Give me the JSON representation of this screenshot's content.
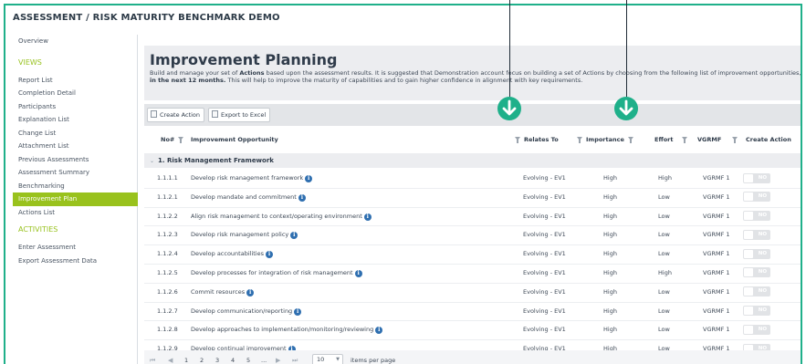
{
  "app": {
    "title": "ASSESSMENT / RISK MATURITY BENCHMARK DEMO"
  },
  "sidebar": {
    "top_items": [
      "Overview"
    ],
    "views_header": "VIEWS",
    "views_items": [
      {
        "label": "Report List"
      },
      {
        "label": "Completion Detail"
      },
      {
        "label": "Participants"
      },
      {
        "label": "Explanation List"
      },
      {
        "label": "Change List"
      },
      {
        "label": "Attachment List"
      },
      {
        "label": "Previous Assessments"
      },
      {
        "label": "Assessment Summary"
      },
      {
        "label": "Benchmarking"
      },
      {
        "label": "Improvement Plan",
        "active": true
      },
      {
        "label": "Actions List"
      }
    ],
    "activities_header": "ACTIVITIES",
    "activities_items": [
      {
        "label": "Enter Assessment"
      },
      {
        "label": "Export Assessment Data"
      }
    ]
  },
  "page": {
    "title": "Improvement Planning",
    "intro_line1_a": "Build and manage your set of ",
    "intro_line1_b": "Actions",
    "intro_line1_c": " based upon the assessment results. It is suggested that Demonstration account focus on building a set of Actions by choosing from the following list of improvement opportunities, a",
    "intro_line2_a": "in the next 12 months.",
    "intro_line2_b": " This will help to improve the maturity of capabilities and to gain higher confidence in alignment with key requirements."
  },
  "toolbar": {
    "create_action": "Create Action",
    "export_excel": "Export to Excel"
  },
  "grid": {
    "columns": {
      "no": "No#",
      "opportunity": "Improvement Opportunity",
      "relates_to": "Relates To",
      "importance": "Importance",
      "effort": "Effort",
      "vgrmf": "VGRMF",
      "create_action": "Create Action"
    },
    "group_label": "1. Risk Management Framework",
    "rows": [
      {
        "no": "1.1.1.1",
        "opportunity": "Develop risk management framework",
        "relates_to": "Evolving - EV1",
        "importance": "High",
        "effort": "High",
        "vgrmf": "VGRMF 1",
        "toggle": "NO"
      },
      {
        "no": "1.1.2.1",
        "opportunity": "Develop mandate and commitment",
        "relates_to": "Evolving - EV1",
        "importance": "High",
        "effort": "Low",
        "vgrmf": "VGRMF 1",
        "toggle": "NO"
      },
      {
        "no": "1.1.2.2",
        "opportunity": "Align risk management to context/operating environment",
        "relates_to": "Evolving - EV1",
        "importance": "High",
        "effort": "Low",
        "vgrmf": "VGRMF 1",
        "toggle": "NO"
      },
      {
        "no": "1.1.2.3",
        "opportunity": "Develop risk management policy",
        "relates_to": "Evolving - EV1",
        "importance": "High",
        "effort": "Low",
        "vgrmf": "VGRMF 1",
        "toggle": "NO"
      },
      {
        "no": "1.1.2.4",
        "opportunity": "Develop accountabilities",
        "relates_to": "Evolving - EV1",
        "importance": "High",
        "effort": "Low",
        "vgrmf": "VGRMF 1",
        "toggle": "NO"
      },
      {
        "no": "1.1.2.5",
        "opportunity": "Develop processes for integration of risk management",
        "relates_to": "Evolving - EV1",
        "importance": "High",
        "effort": "High",
        "vgrmf": "VGRMF 1",
        "toggle": "NO"
      },
      {
        "no": "1.1.2.6",
        "opportunity": "Commit resources",
        "relates_to": "Evolving - EV1",
        "importance": "High",
        "effort": "Low",
        "vgrmf": "VGRMF 1",
        "toggle": "NO"
      },
      {
        "no": "1.1.2.7",
        "opportunity": "Develop communication/reporting",
        "relates_to": "Evolving - EV1",
        "importance": "High",
        "effort": "Low",
        "vgrmf": "VGRMF 1",
        "toggle": "NO"
      },
      {
        "no": "1.1.2.8",
        "opportunity": "Develop approaches to implementation/monitoring/reviewing",
        "relates_to": "Evolving - EV1",
        "importance": "High",
        "effort": "Low",
        "vgrmf": "VGRMF 1",
        "toggle": "NO"
      },
      {
        "no": "1.1.2.9",
        "opportunity": "Develop continual improvement",
        "relates_to": "Evolving - EV1",
        "importance": "High",
        "effort": "Low",
        "vgrmf": "VGRMF 1",
        "toggle": "NO"
      }
    ]
  },
  "pager": {
    "first": "⏮",
    "prev": "◀",
    "pages": [
      "1",
      "2",
      "3",
      "4",
      "5",
      "..."
    ],
    "current_page": "1",
    "next": "▶",
    "last": "⏭",
    "page_size": "10",
    "page_size_label": "items per page"
  },
  "colors": {
    "accent": "#1fb08a",
    "nav_active": "#99c21d",
    "section": "#98c21f"
  },
  "icons": {
    "info": "info-icon",
    "filter": "filter-icon",
    "marker": "arrow-down-circle-icon"
  }
}
